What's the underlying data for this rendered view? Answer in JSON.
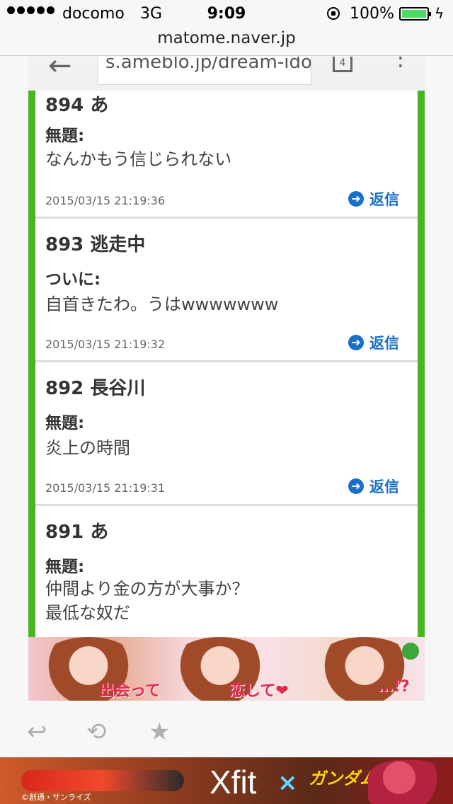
{
  "status_bar": {
    "carrier": "docomo",
    "network": "3G",
    "time": "9:09",
    "battery_percent": "100%",
    "battery_icon": "battery-charging-icon",
    "lock_icon": "orientation-lock-icon"
  },
  "page_url": "matome.naver.jp",
  "inner_browser": {
    "address": "s.ameblo.jp/dream-idol",
    "tab_count": "4"
  },
  "posts": [
    {
      "number_name": "894 あ",
      "subject": "無題:",
      "body": [
        "なんかもう信じられない"
      ],
      "date": "2015/03/15 21:19:36",
      "reply_label": "返信"
    },
    {
      "number_name": "893 逃走中",
      "subject": "ついに:",
      "body": [
        "自首きたわ。うはwwwwwww"
      ],
      "date": "2015/03/15 21:19:32",
      "reply_label": "返信"
    },
    {
      "number_name": "892 長谷川",
      "subject": "無題:",
      "body": [
        "炎上の時間"
      ],
      "date": "2015/03/15 21:19:31",
      "reply_label": "返信"
    },
    {
      "number_name": "891 あ",
      "subject": "無題:",
      "body": [
        "仲間より金の方が大事か？",
        "最低な奴だ"
      ],
      "date": "",
      "reply_label": ""
    }
  ],
  "ad_banner": {
    "text1": "出会って",
    "text2": "恋して❤",
    "text3": "…!?"
  },
  "toolbar": {
    "reply_icon": "reply-icon",
    "retweet_icon": "retweet-icon",
    "favorite_icon": "star-icon"
  },
  "bottom_ad": {
    "brand": "Xfit",
    "cross": "×",
    "gundam": "ガンダム",
    "credit": "©創通・サンライズ"
  },
  "colors": {
    "accent_green": "#4ab522",
    "link_blue": "#1a6fc9",
    "battery_green": "#4cd964"
  }
}
